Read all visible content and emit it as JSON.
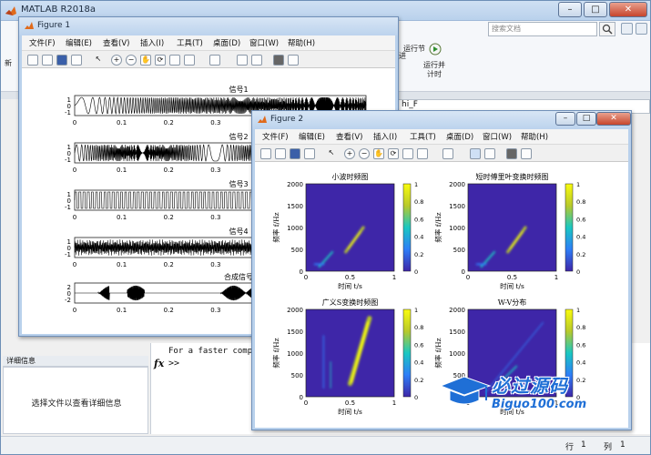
{
  "main": {
    "title": "MATLAB R2018a",
    "search_placeholder": "搜索文档",
    "tool_run_section": "运行节",
    "tool_run_advance_1": "运行并",
    "tool_run_advance_2": "计时",
    "tool_left_label": "新",
    "tool_advance_label": "进",
    "panel_path": "hi_F",
    "details_header": "详细信息",
    "details_text": "选择文件以查看详细信息",
    "cmd_message": "For a faster compu",
    "prompt": ">>",
    "status_row_label": "行",
    "status_row_value": "1",
    "status_col_label": "列",
    "status_col_value": "1"
  },
  "menu": [
    "文件(F)",
    "编辑(E)",
    "查看(V)",
    "插入(I)",
    "工具(T)",
    "桌面(D)",
    "窗口(W)",
    "帮助(H)"
  ],
  "figure1": {
    "title": "Figure 1",
    "subplots": [
      {
        "title": "信号1",
        "pattern": "chirp"
      },
      {
        "title": "信号2",
        "pattern": "dense"
      },
      {
        "title": "信号3",
        "pattern": "square"
      },
      {
        "title": "信号4",
        "pattern": "noise"
      },
      {
        "title": "合成信号",
        "pattern": "bursts"
      }
    ],
    "yticks": [
      "1",
      "0",
      "-1"
    ],
    "yticks_last": [
      "2",
      "0",
      "-2"
    ],
    "xticks": [
      "0",
      "0.1",
      "0.2",
      "0.3",
      "0.4",
      "0.5",
      "0.6"
    ]
  },
  "figure2": {
    "title": "Figure 2",
    "panels": [
      {
        "title": "小波时频图"
      },
      {
        "title": "短时傅里叶变换时频图"
      },
      {
        "title": "广义S变换时频图"
      },
      {
        "title": "W-V分布"
      }
    ],
    "ylabel": "频率 f/Hz",
    "xlabel": "时间 t/s",
    "yticks": [
      "2000",
      "1500",
      "1000",
      "500",
      "0"
    ],
    "xticks": [
      "0",
      "0.5",
      "1"
    ],
    "colorbar_ticks": [
      "1",
      "0.8",
      "0.6",
      "0.4",
      "0.2",
      "0"
    ]
  },
  "watermark": {
    "text": "必过源码",
    "url": "Biguo100.com"
  },
  "colors": {
    "plot_bg": "#3e26a8",
    "plot_line": "#000000",
    "ridge": "#f9fb0e"
  },
  "icons": {
    "matlab": "matlab-logo-icon",
    "figure": "figure-window-icon",
    "search": "search-icon"
  }
}
